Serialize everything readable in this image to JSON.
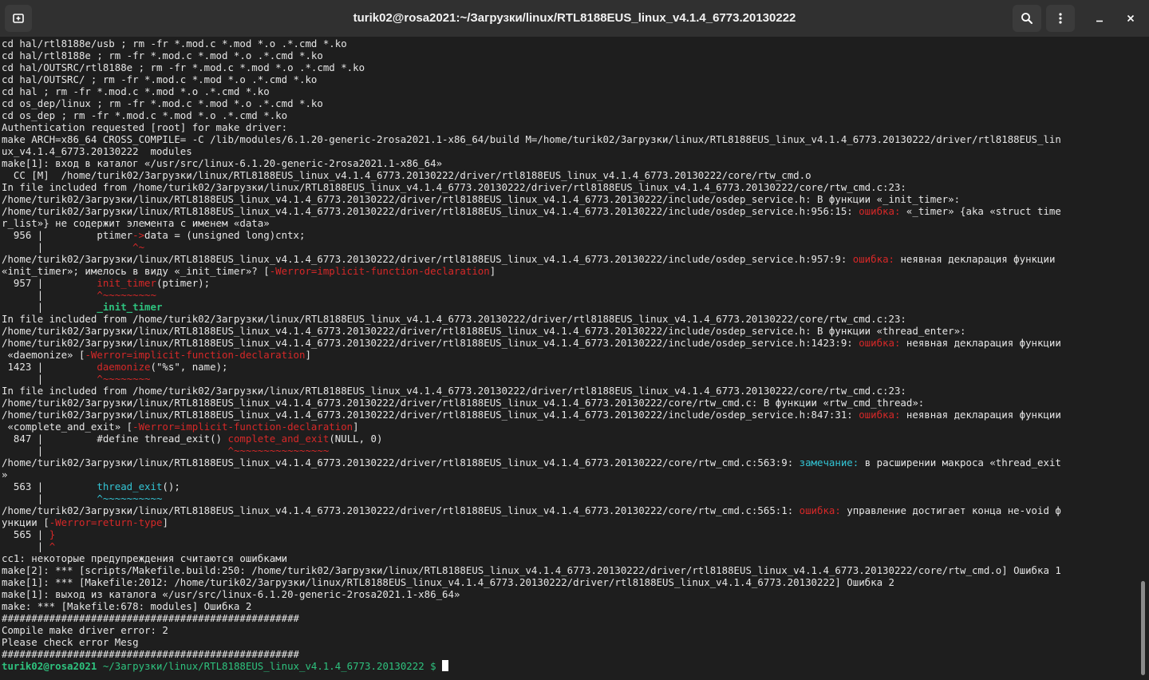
{
  "window": {
    "title": "turik02@rosa2021:~/Загрузки/linux/RTL8188EUS_linux_v4.1.4_6773.20130222",
    "icons": {
      "new_tab": "new-tab-icon",
      "search": "search-icon",
      "menu": "kebab-menu-icon",
      "minimize": "minimize-icon",
      "close": "close-icon"
    }
  },
  "colors": {
    "background": "#1e1e1e",
    "titlebar": "#303030",
    "text": "#e6e6e6",
    "error": "#d62828",
    "note": "#33c4d4",
    "prompt": "#2ec27e"
  },
  "terminal": {
    "lines": [
      [
        {
          "t": "cd hal/rtl8188e/usb ; rm -fr *.mod.c *.mod *.o .*.cmd *.ko"
        }
      ],
      [
        {
          "t": "cd hal/rtl8188e ; rm -fr *.mod.c *.mod *.o .*.cmd *.ko"
        }
      ],
      [
        {
          "t": "cd hal/OUTSRC/rtl8188e ; rm -fr *.mod.c *.mod *.o .*.cmd *.ko"
        }
      ],
      [
        {
          "t": "cd hal/OUTSRC/ ; rm -fr *.mod.c *.mod *.o .*.cmd *.ko"
        }
      ],
      [
        {
          "t": "cd hal ; rm -fr *.mod.c *.mod *.o .*.cmd *.ko"
        }
      ],
      [
        {
          "t": "cd os_dep/linux ; rm -fr *.mod.c *.mod *.o .*.cmd *.ko"
        }
      ],
      [
        {
          "t": "cd os_dep ; rm -fr *.mod.c *.mod *.o .*.cmd *.ko"
        }
      ],
      [
        {
          "t": "Authentication requested [root] for make driver:"
        }
      ],
      [
        {
          "t": "make ARCH=x86_64 CROSS_COMPILE= -C /lib/modules/6.1.20-generic-2rosa2021.1-x86_64/build M=/home/turik02/Загрузки/linux/RTL8188EUS_linux_v4.1.4_6773.20130222/driver/rtl8188EUS_lin"
        }
      ],
      [
        {
          "t": "ux_v4.1.4_6773.20130222  modules"
        }
      ],
      [
        {
          "t": "make[1]: вход в каталог «/usr/src/linux-6.1.20-generic-2rosa2021.1-x86_64»"
        }
      ],
      [
        {
          "t": "  CC [M]  /home/turik02/Загрузки/linux/RTL8188EUS_linux_v4.1.4_6773.20130222/driver/rtl8188EUS_linux_v4.1.4_6773.20130222/core/rtw_cmd.o"
        }
      ],
      [
        {
          "t": "In file included from /home/turik02/Загрузки/linux/RTL8188EUS_linux_v4.1.4_6773.20130222/driver/rtl8188EUS_linux_v4.1.4_6773.20130222/core/rtw_cmd.c:23:"
        }
      ],
      [
        {
          "t": "/home/turik02/Загрузки/linux/RTL8188EUS_linux_v4.1.4_6773.20130222/driver/rtl8188EUS_linux_v4.1.4_6773.20130222/include/osdep_service.h: В функции «_init_timer»:"
        }
      ],
      [
        {
          "t": "/home/turik02/Загрузки/linux/RTL8188EUS_linux_v4.1.4_6773.20130222/driver/rtl8188EUS_linux_v4.1.4_6773.20130222/include/osdep_service.h:956:15: "
        },
        {
          "t": "ошибка:",
          "c": "error"
        },
        {
          "t": " «_timer» {aka «struct time"
        }
      ],
      [
        {
          "t": "r_list»} не содержит элемента с именем «data»"
        }
      ],
      [
        {
          "t": "  956 |         ptimer"
        },
        {
          "t": "->",
          "c": "error"
        },
        {
          "t": "data = (unsigned long)cntx;"
        }
      ],
      [
        {
          "t": "      |               "
        },
        {
          "t": "^~",
          "c": "error"
        }
      ],
      [
        {
          "t": "/home/turik02/Загрузки/linux/RTL8188EUS_linux_v4.1.4_6773.20130222/driver/rtl8188EUS_linux_v4.1.4_6773.20130222/include/osdep_service.h:957:9: "
        },
        {
          "t": "ошибка:",
          "c": "error"
        },
        {
          "t": " неявная декларация функции"
        }
      ],
      [
        {
          "t": "«init_timer»; имелось в виду «_init_timer»? ["
        },
        {
          "t": "-Werror=implicit-function-declaration",
          "c": "error"
        },
        {
          "t": "]"
        }
      ],
      [
        {
          "t": "  957 |         "
        },
        {
          "t": "init_timer",
          "c": "error"
        },
        {
          "t": "(ptimer);"
        }
      ],
      [
        {
          "t": "      |         "
        },
        {
          "t": "^~~~~~~~~~",
          "c": "error"
        }
      ],
      [
        {
          "t": "      |         "
        },
        {
          "t": "_init_timer",
          "c": "prompt"
        }
      ],
      [
        {
          "t": "In file included from /home/turik02/Загрузки/linux/RTL8188EUS_linux_v4.1.4_6773.20130222/driver/rtl8188EUS_linux_v4.1.4_6773.20130222/core/rtw_cmd.c:23:"
        }
      ],
      [
        {
          "t": "/home/turik02/Загрузки/linux/RTL8188EUS_linux_v4.1.4_6773.20130222/driver/rtl8188EUS_linux_v4.1.4_6773.20130222/include/osdep_service.h: В функции «thread_enter»:"
        }
      ],
      [
        {
          "t": "/home/turik02/Загрузки/linux/RTL8188EUS_linux_v4.1.4_6773.20130222/driver/rtl8188EUS_linux_v4.1.4_6773.20130222/include/osdep_service.h:1423:9: "
        },
        {
          "t": "ошибка:",
          "c": "error"
        },
        {
          "t": " неявная декларация функции"
        }
      ],
      [
        {
          "t": " «daemonize» ["
        },
        {
          "t": "-Werror=implicit-function-declaration",
          "c": "error"
        },
        {
          "t": "]"
        }
      ],
      [
        {
          "t": " 1423 |         "
        },
        {
          "t": "daemonize",
          "c": "error"
        },
        {
          "t": "(\"%s\", name);"
        }
      ],
      [
        {
          "t": "      |         "
        },
        {
          "t": "^~~~~~~~~",
          "c": "error"
        }
      ],
      [
        {
          "t": "In file included from /home/turik02/Загрузки/linux/RTL8188EUS_linux_v4.1.4_6773.20130222/driver/rtl8188EUS_linux_v4.1.4_6773.20130222/core/rtw_cmd.c:23:"
        }
      ],
      [
        {
          "t": "/home/turik02/Загрузки/linux/RTL8188EUS_linux_v4.1.4_6773.20130222/driver/rtl8188EUS_linux_v4.1.4_6773.20130222/core/rtw_cmd.c: В функции «rtw_cmd_thread»:"
        }
      ],
      [
        {
          "t": "/home/turik02/Загрузки/linux/RTL8188EUS_linux_v4.1.4_6773.20130222/driver/rtl8188EUS_linux_v4.1.4_6773.20130222/include/osdep_service.h:847:31: "
        },
        {
          "t": "ошибка:",
          "c": "error"
        },
        {
          "t": " неявная декларация функции"
        }
      ],
      [
        {
          "t": " «complete_and_exit» ["
        },
        {
          "t": "-Werror=implicit-function-declaration",
          "c": "error"
        },
        {
          "t": "]"
        }
      ],
      [
        {
          "t": "  847 |         #define thread_exit() "
        },
        {
          "t": "complete_and_exit",
          "c": "error"
        },
        {
          "t": "(NULL, 0)"
        }
      ],
      [
        {
          "t": "      |                               "
        },
        {
          "t": "^~~~~~~~~~~~~~~~~",
          "c": "error"
        }
      ],
      [
        {
          "t": "/home/turik02/Загрузки/linux/RTL8188EUS_linux_v4.1.4_6773.20130222/driver/rtl8188EUS_linux_v4.1.4_6773.20130222/core/rtw_cmd.c:563:9: "
        },
        {
          "t": "замечание:",
          "c": "note"
        },
        {
          "t": " в расширении макроса «thread_exit"
        }
      ],
      [
        {
          "t": "»"
        }
      ],
      [
        {
          "t": "  563 |         "
        },
        {
          "t": "thread_exit",
          "c": "note"
        },
        {
          "t": "();"
        }
      ],
      [
        {
          "t": "      |         "
        },
        {
          "t": "^~~~~~~~~~~",
          "c": "note"
        }
      ],
      [
        {
          "t": "/home/turik02/Загрузки/linux/RTL8188EUS_linux_v4.1.4_6773.20130222/driver/rtl8188EUS_linux_v4.1.4_6773.20130222/core/rtw_cmd.c:565:1: "
        },
        {
          "t": "ошибка:",
          "c": "error"
        },
        {
          "t": " управление достигает конца не-void ф"
        }
      ],
      [
        {
          "t": "ункции ["
        },
        {
          "t": "-Werror=return-type",
          "c": "error"
        },
        {
          "t": "]"
        }
      ],
      [
        {
          "t": "  565 | "
        },
        {
          "t": "}",
          "c": "error"
        }
      ],
      [
        {
          "t": "      | "
        },
        {
          "t": "^",
          "c": "error"
        }
      ],
      [
        {
          "t": "cc1: некоторые предупреждения считаются ошибками"
        }
      ],
      [
        {
          "t": "make[2]: *** [scripts/Makefile.build:250: /home/turik02/Загрузки/linux/RTL8188EUS_linux_v4.1.4_6773.20130222/driver/rtl8188EUS_linux_v4.1.4_6773.20130222/core/rtw_cmd.o] Ошибка 1"
        }
      ],
      [
        {
          "t": "make[1]: *** [Makefile:2012: /home/turik02/Загрузки/linux/RTL8188EUS_linux_v4.1.4_6773.20130222/driver/rtl8188EUS_linux_v4.1.4_6773.20130222] Ошибка 2"
        }
      ],
      [
        {
          "t": "make[1]: выход из каталога «/usr/src/linux-6.1.20-generic-2rosa2021.1-x86_64»"
        }
      ],
      [
        {
          "t": "make: *** [Makefile:678: modules] Ошибка 2"
        }
      ],
      [
        {
          "t": "##################################################"
        }
      ],
      [
        {
          "t": "Compile make driver error: 2"
        }
      ],
      [
        {
          "t": "Please check error Mesg"
        }
      ],
      [
        {
          "t": "##################################################"
        }
      ],
      [
        {
          "t": "turik02@rosa2021",
          "c": "prompt"
        },
        {
          "t": " "
        },
        {
          "t": "~/Загрузки/linux/RTL8188EUS_linux_v4.1.4_6773.20130222 $",
          "c": "prompt_path"
        },
        {
          "t": " "
        }
      ]
    ]
  }
}
